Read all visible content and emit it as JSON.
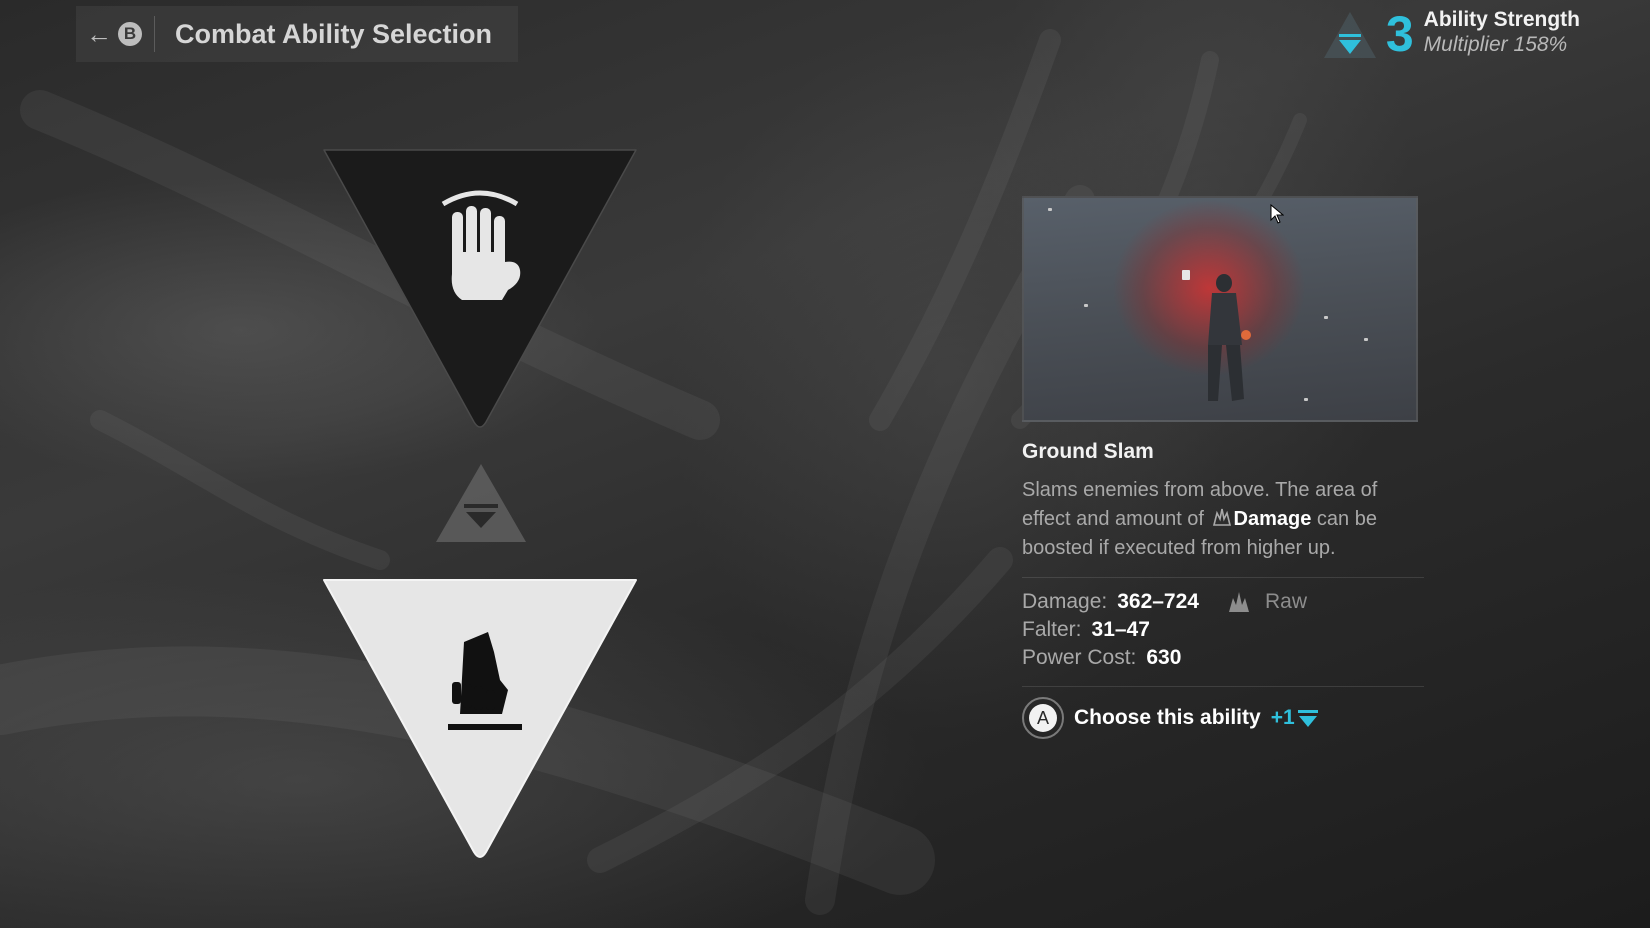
{
  "header": {
    "back_button_glyph": "B",
    "title": "Combat Ability Selection"
  },
  "strength": {
    "points": "3",
    "label": "Ability Strength",
    "multiplier": "Multiplier 158%",
    "accent_color": "#2fc0dc"
  },
  "tree": {
    "top_node_icon": "hand-icon",
    "mid_node_icon": "strength-point-icon",
    "bottom_node_icon": "ground-slam-fist-icon",
    "selected": "bottom"
  },
  "ability": {
    "name": "Ground Slam",
    "description_part1": "Slams enemies from above. The area of effect and amount of",
    "description_keyword": "Damage",
    "description_part2": "can be boosted if executed from higher up.",
    "stats": {
      "damage_label": "Damage:",
      "damage_value": "362–724",
      "damage_type": "Raw",
      "falter_label": "Falter:",
      "falter_value": "31–47",
      "power_label": "Power Cost:",
      "power_value": "630"
    }
  },
  "action": {
    "button_glyph": "A",
    "label": "Choose this ability",
    "bonus": "+1"
  }
}
